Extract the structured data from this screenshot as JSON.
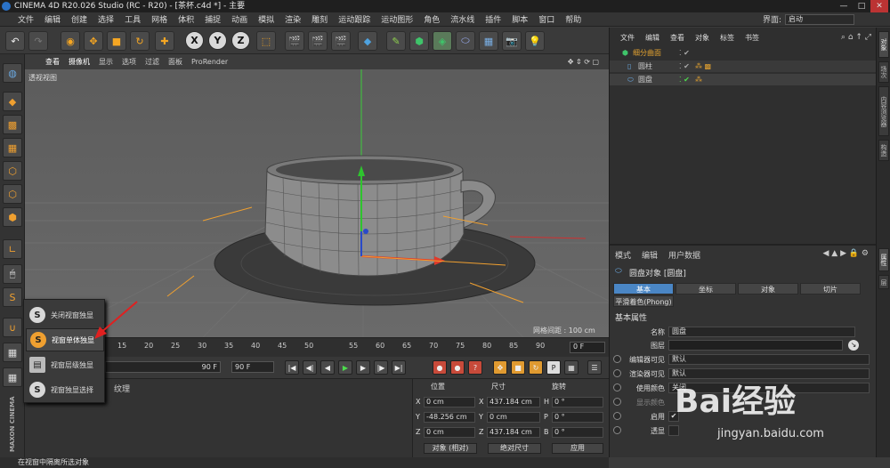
{
  "app": {
    "title": "CINEMA 4D R20.026 Studio (RC - R20) - [茶杯.c4d *] - 主要",
    "window_buttons": [
      "—",
      "□",
      "✕"
    ]
  },
  "menubar": {
    "items": [
      "文件",
      "编辑",
      "创建",
      "选择",
      "工具",
      "网格",
      "体积",
      "捕捉",
      "动画",
      "模拟",
      "渲染",
      "雕刻",
      "运动跟踪",
      "运动图形",
      "角色",
      "流水线",
      "插件",
      "脚本",
      "窗口",
      "帮助"
    ],
    "layout_label": "界面:",
    "layout_value": "启动"
  },
  "toolbar": {
    "undo": "↶",
    "redo": "↷",
    "x": "X",
    "y": "Y",
    "z": "Z"
  },
  "viewport": {
    "menu": [
      "查看",
      "摄像机",
      "显示",
      "选项",
      "过滤",
      "面板",
      "ProRender"
    ],
    "label": "透视视图",
    "grid_spacing": "网格间距 : 100 cm"
  },
  "timeline": {
    "ticks": [
      "15",
      "20",
      "25",
      "30",
      "35",
      "40",
      "45",
      "50",
      "55",
      "60",
      "65",
      "70",
      "75",
      "80",
      "85",
      "90"
    ],
    "frame": "0 F",
    "end_a": "90 F",
    "end_b": "90 F"
  },
  "material": {
    "menu": "纹理"
  },
  "coords": {
    "headers": [
      "位置",
      "尺寸",
      "旋转"
    ],
    "rows": [
      {
        "axis": "X",
        "pos": "0 cm",
        "size_axis": "X",
        "size": "437.184 cm",
        "rot_axis": "H",
        "rot": "0 °"
      },
      {
        "axis": "Y",
        "pos": "-48.256 cm",
        "size_axis": "Y",
        "size": "0 cm",
        "rot_axis": "P",
        "rot": "0 °"
      },
      {
        "axis": "Z",
        "pos": "0 cm",
        "size_axis": "Z",
        "size": "437.184 cm",
        "rot_axis": "B",
        "rot": "0 °"
      }
    ],
    "mode_a": "对象 (相对)",
    "mode_b": "绝对尺寸",
    "apply": "应用"
  },
  "status": "在视窗中隔离所选对象",
  "objects": {
    "menu": [
      "文件",
      "编辑",
      "查看",
      "对象",
      "标签",
      "书签"
    ],
    "rows": [
      {
        "name": "细分曲面",
        "color": "#e0a030",
        "indent": 0
      },
      {
        "name": "圆柱",
        "color": "#dddddd",
        "indent": 1
      },
      {
        "name": "圆盘",
        "color": "#dddddd",
        "indent": 1
      }
    ]
  },
  "attributes": {
    "menu": [
      "模式",
      "编辑",
      "用户数据"
    ],
    "object_title": "圆盘对象 [圆盘]",
    "tabs": [
      "基本",
      "坐标",
      "对象",
      "切片"
    ],
    "phong_tab": "平滑着色(Phong)",
    "section": "基本属性",
    "fields": [
      {
        "label": "名称",
        "value": "圆盘",
        "radio": false
      },
      {
        "label": "图层",
        "value": "",
        "radio": false
      },
      {
        "label": "编辑器可见",
        "value": "默认",
        "radio": true
      },
      {
        "label": "渲染器可见",
        "value": "默认",
        "radio": true
      },
      {
        "label": "使用颜色",
        "value": "关闭",
        "radio": true
      },
      {
        "label": "显示颜色",
        "value": "",
        "radio": true
      },
      {
        "label": "启用",
        "value": "✔",
        "radio": true
      },
      {
        "label": "透显",
        "value": "",
        "radio": true
      }
    ]
  },
  "side_tabs": [
    "对象",
    "场次",
    "内容浏览器",
    "构造",
    "属性",
    "层"
  ],
  "popup": {
    "items": [
      "关闭视窗独显",
      "视窗单体独显",
      "视窗层级独显",
      "视窗独显选择"
    ],
    "active_index": 1
  },
  "brand": "MAXON CINEMA 4D",
  "watermark": {
    "main": "Bai经验",
    "url": "jingyan.baidu.com"
  }
}
